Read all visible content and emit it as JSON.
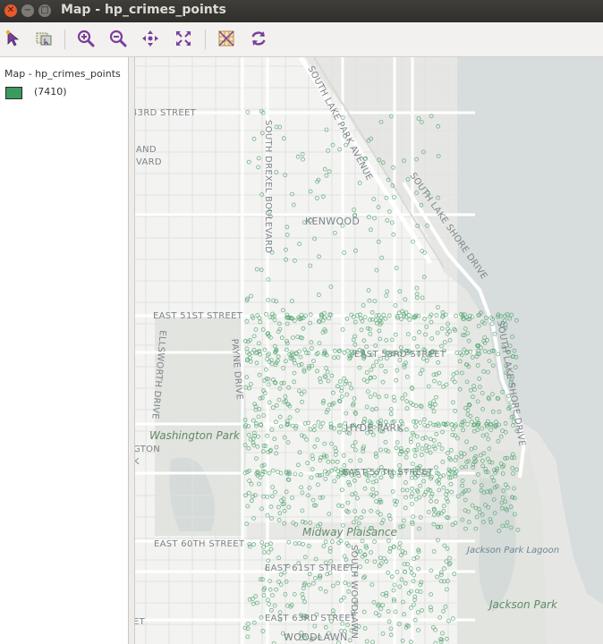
{
  "window": {
    "title": "Map - hp_crimes_points"
  },
  "toolbar": {
    "tools": [
      {
        "name": "select-tool",
        "icon": "pointer-arrow-icon"
      },
      {
        "name": "select-area-tool",
        "icon": "select-area-icon"
      },
      {
        "name": "zoom-in-tool",
        "icon": "zoom-in-icon"
      },
      {
        "name": "zoom-out-tool",
        "icon": "zoom-out-icon"
      },
      {
        "name": "pan-tool",
        "icon": "pan-arrows-icon"
      },
      {
        "name": "zoom-full-tool",
        "icon": "zoom-full-icon"
      },
      {
        "name": "basemap-tool",
        "icon": "basemap-icon"
      },
      {
        "name": "refresh-tool",
        "icon": "refresh-icon"
      }
    ]
  },
  "legend": {
    "layer_title": "Map - hp_crimes_points",
    "count": "(7410)",
    "swatch_color": "#3a9a5f"
  },
  "map": {
    "point_color": "#5aa877",
    "labels": {
      "e43rd": "43RD STREET",
      "and": "AND",
      "vard": "VARD",
      "lake_park": "SOUTH LAKE PARK AVENUE",
      "drexel": "SOUTH DREXEL BOULEVARD",
      "shore1": "SOUTH LAKE SHORE DRIVE",
      "kenwood": "KENWOOD",
      "e51st": "EAST 51ST STREET",
      "e53rd": "EAST 53RD STREET",
      "ellsworth": "ELLSWORTH DRIVE",
      "payne": "PAYNE DRIVE",
      "shore2": "SOUTH LAKE SHORE DRIVE",
      "hyde_park": "HYDE PARK",
      "washington_park": "Washington Park",
      "gton": "GTON",
      "k": "K",
      "e57th": "EAST 57TH STREET",
      "midway": "Midway Plaisance",
      "e60th": "EAST 60TH STREET",
      "jackson_lagoon": "Jackson Park Lagoon",
      "e61st": "EAST 61ST STREET",
      "woodlawn_ave": "SOUTH WOODLAWN",
      "jackson_park": "Jackson Park",
      "e63rd": "EAST 63RD STREET",
      "woodlawn": "WOODLAWN",
      "et": "ET"
    }
  }
}
